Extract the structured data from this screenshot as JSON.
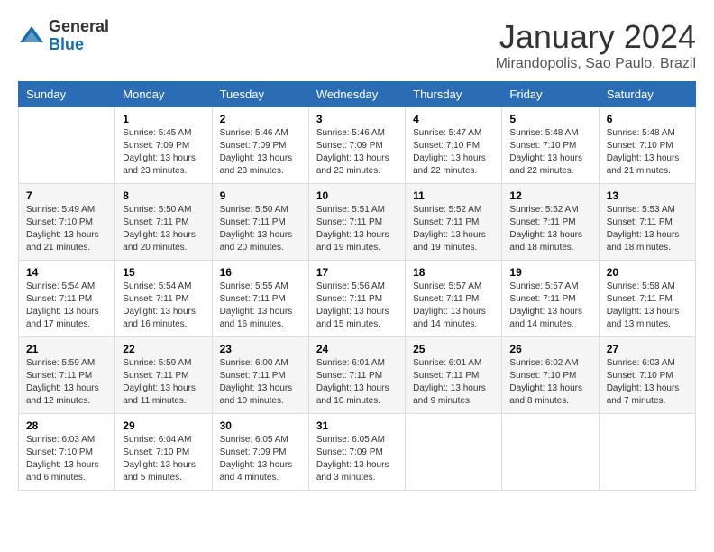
{
  "header": {
    "logo": {
      "line1": "General",
      "line2": "Blue"
    },
    "title": "January 2024",
    "location": "Mirandopolis, Sao Paulo, Brazil"
  },
  "days_of_week": [
    "Sunday",
    "Monday",
    "Tuesday",
    "Wednesday",
    "Thursday",
    "Friday",
    "Saturday"
  ],
  "weeks": [
    [
      {
        "day": "",
        "sunrise": "",
        "sunset": "",
        "daylight": ""
      },
      {
        "day": "1",
        "sunrise": "Sunrise: 5:45 AM",
        "sunset": "Sunset: 7:09 PM",
        "daylight": "Daylight: 13 hours and 23 minutes."
      },
      {
        "day": "2",
        "sunrise": "Sunrise: 5:46 AM",
        "sunset": "Sunset: 7:09 PM",
        "daylight": "Daylight: 13 hours and 23 minutes."
      },
      {
        "day": "3",
        "sunrise": "Sunrise: 5:46 AM",
        "sunset": "Sunset: 7:09 PM",
        "daylight": "Daylight: 13 hours and 23 minutes."
      },
      {
        "day": "4",
        "sunrise": "Sunrise: 5:47 AM",
        "sunset": "Sunset: 7:10 PM",
        "daylight": "Daylight: 13 hours and 22 minutes."
      },
      {
        "day": "5",
        "sunrise": "Sunrise: 5:48 AM",
        "sunset": "Sunset: 7:10 PM",
        "daylight": "Daylight: 13 hours and 22 minutes."
      },
      {
        "day": "6",
        "sunrise": "Sunrise: 5:48 AM",
        "sunset": "Sunset: 7:10 PM",
        "daylight": "Daylight: 13 hours and 21 minutes."
      }
    ],
    [
      {
        "day": "7",
        "sunrise": "Sunrise: 5:49 AM",
        "sunset": "Sunset: 7:10 PM",
        "daylight": "Daylight: 13 hours and 21 minutes."
      },
      {
        "day": "8",
        "sunrise": "Sunrise: 5:50 AM",
        "sunset": "Sunset: 7:11 PM",
        "daylight": "Daylight: 13 hours and 20 minutes."
      },
      {
        "day": "9",
        "sunrise": "Sunrise: 5:50 AM",
        "sunset": "Sunset: 7:11 PM",
        "daylight": "Daylight: 13 hours and 20 minutes."
      },
      {
        "day": "10",
        "sunrise": "Sunrise: 5:51 AM",
        "sunset": "Sunset: 7:11 PM",
        "daylight": "Daylight: 13 hours and 19 minutes."
      },
      {
        "day": "11",
        "sunrise": "Sunrise: 5:52 AM",
        "sunset": "Sunset: 7:11 PM",
        "daylight": "Daylight: 13 hours and 19 minutes."
      },
      {
        "day": "12",
        "sunrise": "Sunrise: 5:52 AM",
        "sunset": "Sunset: 7:11 PM",
        "daylight": "Daylight: 13 hours and 18 minutes."
      },
      {
        "day": "13",
        "sunrise": "Sunrise: 5:53 AM",
        "sunset": "Sunset: 7:11 PM",
        "daylight": "Daylight: 13 hours and 18 minutes."
      }
    ],
    [
      {
        "day": "14",
        "sunrise": "Sunrise: 5:54 AM",
        "sunset": "Sunset: 7:11 PM",
        "daylight": "Daylight: 13 hours and 17 minutes."
      },
      {
        "day": "15",
        "sunrise": "Sunrise: 5:54 AM",
        "sunset": "Sunset: 7:11 PM",
        "daylight": "Daylight: 13 hours and 16 minutes."
      },
      {
        "day": "16",
        "sunrise": "Sunrise: 5:55 AM",
        "sunset": "Sunset: 7:11 PM",
        "daylight": "Daylight: 13 hours and 16 minutes."
      },
      {
        "day": "17",
        "sunrise": "Sunrise: 5:56 AM",
        "sunset": "Sunset: 7:11 PM",
        "daylight": "Daylight: 13 hours and 15 minutes."
      },
      {
        "day": "18",
        "sunrise": "Sunrise: 5:57 AM",
        "sunset": "Sunset: 7:11 PM",
        "daylight": "Daylight: 13 hours and 14 minutes."
      },
      {
        "day": "19",
        "sunrise": "Sunrise: 5:57 AM",
        "sunset": "Sunset: 7:11 PM",
        "daylight": "Daylight: 13 hours and 14 minutes."
      },
      {
        "day": "20",
        "sunrise": "Sunrise: 5:58 AM",
        "sunset": "Sunset: 7:11 PM",
        "daylight": "Daylight: 13 hours and 13 minutes."
      }
    ],
    [
      {
        "day": "21",
        "sunrise": "Sunrise: 5:59 AM",
        "sunset": "Sunset: 7:11 PM",
        "daylight": "Daylight: 13 hours and 12 minutes."
      },
      {
        "day": "22",
        "sunrise": "Sunrise: 5:59 AM",
        "sunset": "Sunset: 7:11 PM",
        "daylight": "Daylight: 13 hours and 11 minutes."
      },
      {
        "day": "23",
        "sunrise": "Sunrise: 6:00 AM",
        "sunset": "Sunset: 7:11 PM",
        "daylight": "Daylight: 13 hours and 10 minutes."
      },
      {
        "day": "24",
        "sunrise": "Sunrise: 6:01 AM",
        "sunset": "Sunset: 7:11 PM",
        "daylight": "Daylight: 13 hours and 10 minutes."
      },
      {
        "day": "25",
        "sunrise": "Sunrise: 6:01 AM",
        "sunset": "Sunset: 7:11 PM",
        "daylight": "Daylight: 13 hours and 9 minutes."
      },
      {
        "day": "26",
        "sunrise": "Sunrise: 6:02 AM",
        "sunset": "Sunset: 7:10 PM",
        "daylight": "Daylight: 13 hours and 8 minutes."
      },
      {
        "day": "27",
        "sunrise": "Sunrise: 6:03 AM",
        "sunset": "Sunset: 7:10 PM",
        "daylight": "Daylight: 13 hours and 7 minutes."
      }
    ],
    [
      {
        "day": "28",
        "sunrise": "Sunrise: 6:03 AM",
        "sunset": "Sunset: 7:10 PM",
        "daylight": "Daylight: 13 hours and 6 minutes."
      },
      {
        "day": "29",
        "sunrise": "Sunrise: 6:04 AM",
        "sunset": "Sunset: 7:10 PM",
        "daylight": "Daylight: 13 hours and 5 minutes."
      },
      {
        "day": "30",
        "sunrise": "Sunrise: 6:05 AM",
        "sunset": "Sunset: 7:09 PM",
        "daylight": "Daylight: 13 hours and 4 minutes."
      },
      {
        "day": "31",
        "sunrise": "Sunrise: 6:05 AM",
        "sunset": "Sunset: 7:09 PM",
        "daylight": "Daylight: 13 hours and 3 minutes."
      },
      {
        "day": "",
        "sunrise": "",
        "sunset": "",
        "daylight": ""
      },
      {
        "day": "",
        "sunrise": "",
        "sunset": "",
        "daylight": ""
      },
      {
        "day": "",
        "sunrise": "",
        "sunset": "",
        "daylight": ""
      }
    ]
  ]
}
